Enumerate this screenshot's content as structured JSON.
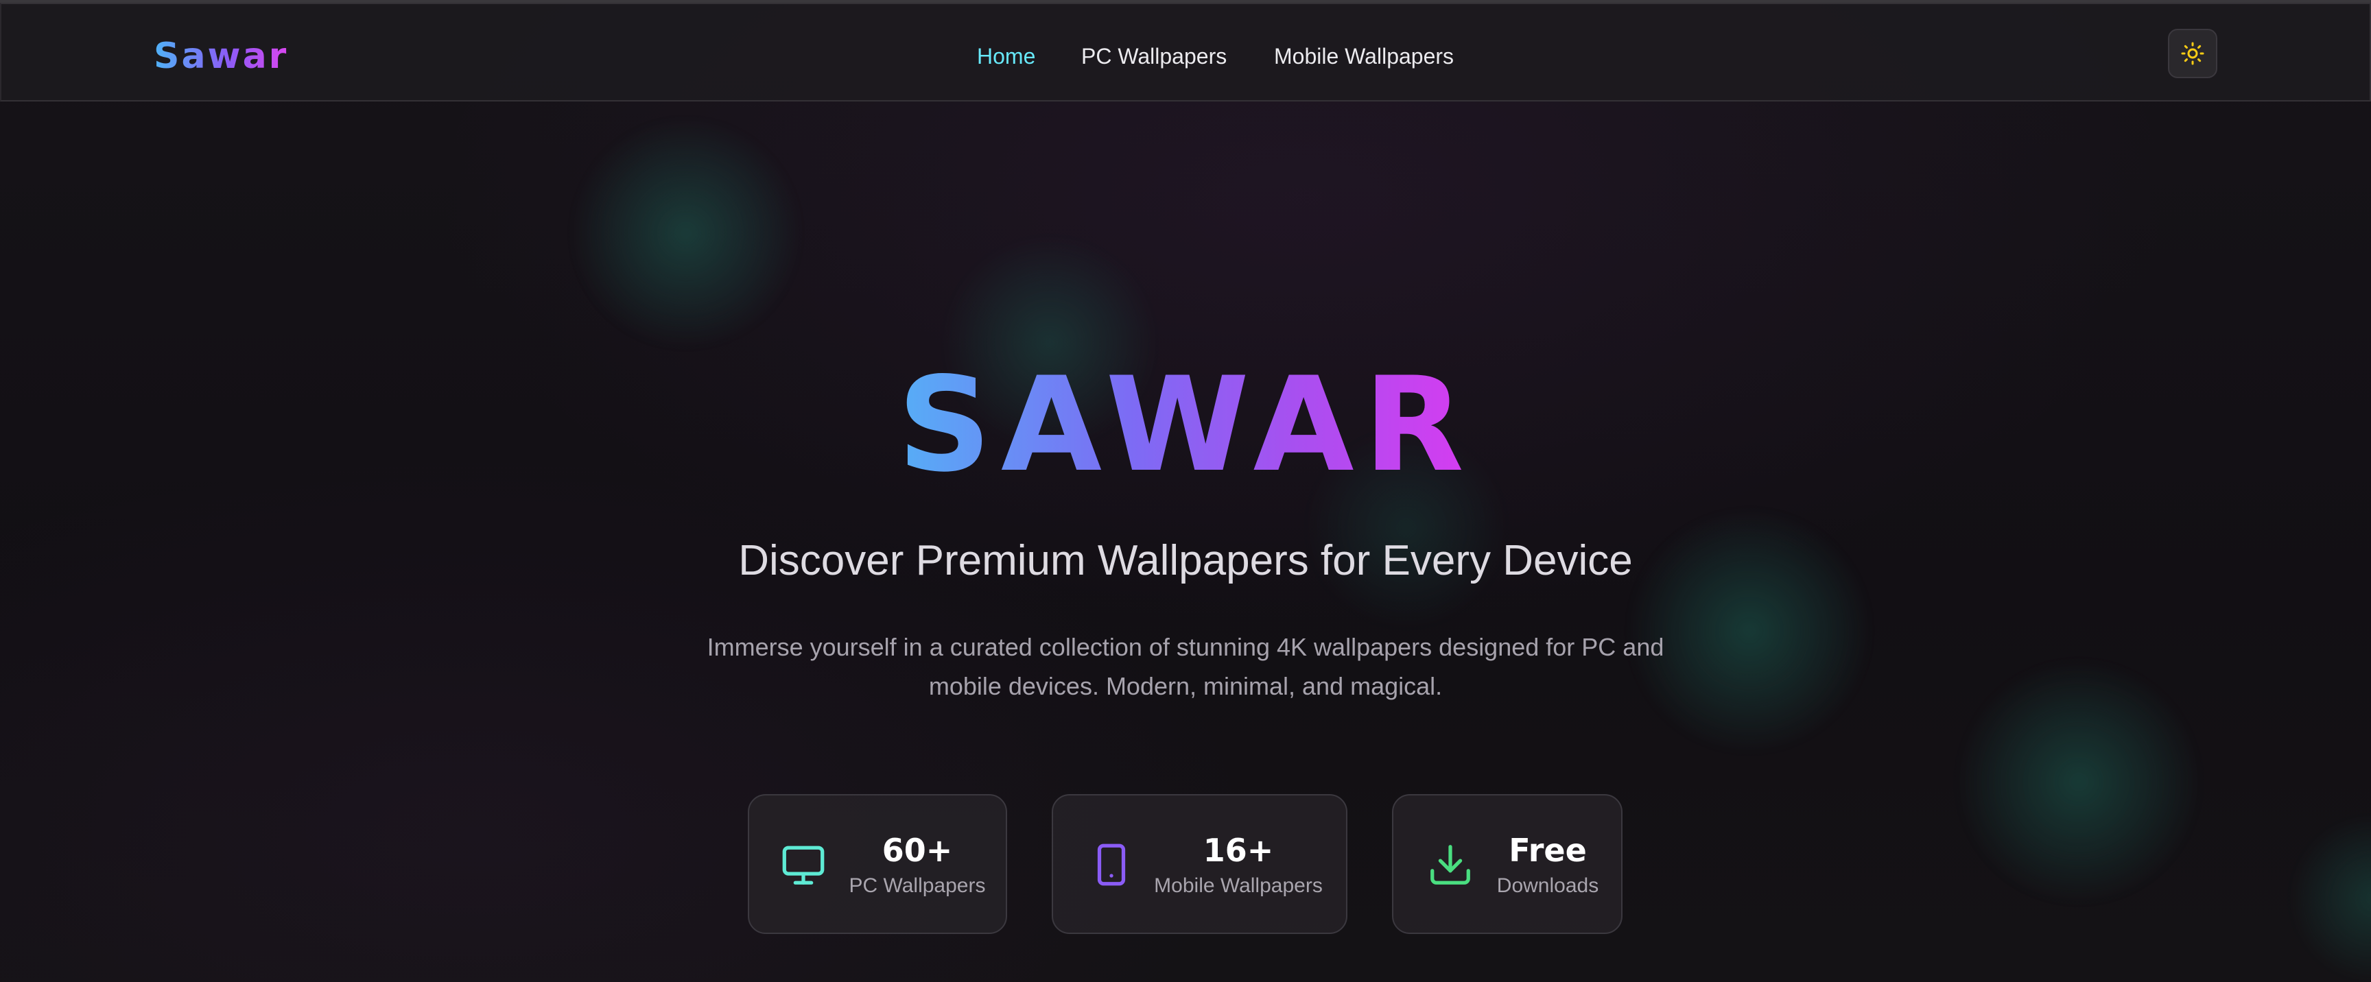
{
  "header": {
    "logo": "Sawar",
    "nav": [
      {
        "label": "Home",
        "active": true
      },
      {
        "label": "PC Wallpapers",
        "active": false
      },
      {
        "label": "Mobile Wallpapers",
        "active": false
      }
    ],
    "theme_toggle_icon": "sun-icon"
  },
  "hero": {
    "title": "SAWAR",
    "tagline": "Discover Premium Wallpapers for Every Device",
    "description": "Immerse yourself in a curated collection of stunning 4K wallpapers designed for PC and mobile devices. Modern, minimal, and magical."
  },
  "stats": [
    {
      "icon": "monitor-icon",
      "value": "60+",
      "label": "PC Wallpapers",
      "color": "#5eead4"
    },
    {
      "icon": "smartphone-icon",
      "value": "16+",
      "label": "Mobile Wallpapers",
      "color": "#8b5cf6"
    },
    {
      "icon": "download-icon",
      "value": "Free",
      "label": "Downloads",
      "color": "#4ade80"
    }
  ],
  "colors": {
    "accent_nav_active": "#67e8f9",
    "gradient_start": "#4fb3f7",
    "gradient_mid": "#8b5cf6",
    "gradient_end": "#d946ef",
    "background": "#131115"
  }
}
